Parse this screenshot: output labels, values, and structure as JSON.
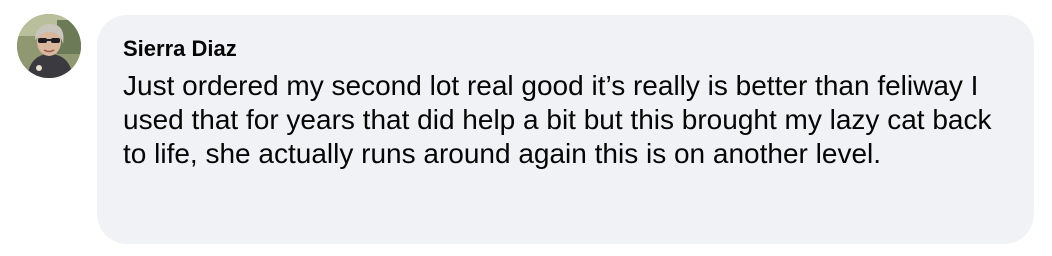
{
  "comment": {
    "author": "Sierra Diaz",
    "text": "Just ordered my second lot real good it’s really is better than feliway I used that for years that did help a bit but this brought my lazy cat back to life, she actually runs around again this is on another level.",
    "avatar_icon": "profile-photo-icon",
    "bubble_color": "#f0f2f5",
    "text_color": "#050505"
  }
}
